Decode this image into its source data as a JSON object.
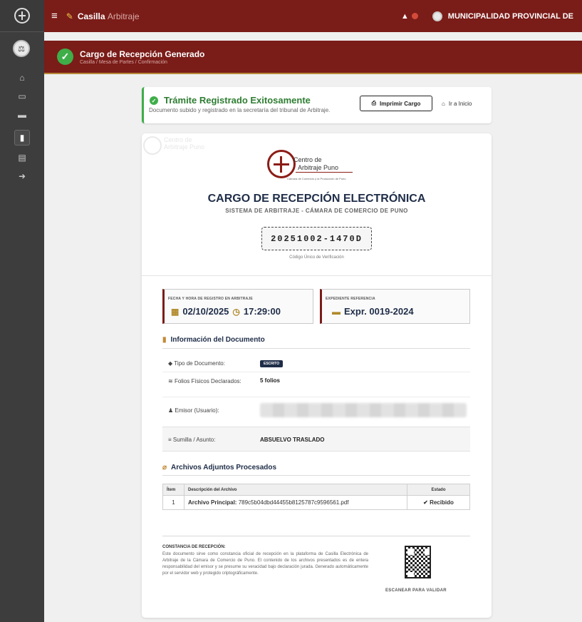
{
  "topbar": {
    "title_bold": "Casilla",
    "title_rest": "Arbitraje",
    "organization": "MUNICIPALIDAD PROVINCIAL DE"
  },
  "banner": {
    "title": "Cargo de Recepción Generado",
    "breadcrumb": "Casilla / Mesa de Partes / Confirmación"
  },
  "success": {
    "title": "Trámite Registrado Exitosamente",
    "description": "Documento subido y registrado en la secretaría del tribunal de Arbitraje.",
    "print_label": "Imprimir Cargo",
    "home_label": "Ir a Inicio"
  },
  "document": {
    "watermark_line1": "Centro de",
    "watermark_line2": "Arbitraje Puno",
    "logo_line1": "Centro de",
    "logo_line2": "Arbitraje Puno",
    "logo_tagline": "Cámara de Comercio y la Producción de Puno",
    "title": "CARGO DE RECEPCIÓN ELECTRÓNICA",
    "subtitle": "SISTEMA DE ARBITRAJE - CÁMARA DE COMERCIO DE PUNO",
    "code": "20251002-1470D",
    "code_label": "Código Único de Verificación",
    "registro_label": "FECHA Y HORA DE REGISTRO EN ARBITRAJE",
    "registro_date": "02/10/2025",
    "registro_time": "17:29:00",
    "expediente_label": "EXPEDIENTE REFERENCIA",
    "expediente_value": "Expr. 0019-2024",
    "info_title": "Información del Documento",
    "tipo_label": "Tipo de Documento:",
    "tipo_value": "ESCRITO",
    "folios_label": "Folios Físicos Declarados:",
    "folios_value": "5 folios",
    "emisor_label": "Emisor (Usuario):",
    "sumilla_label": "Sumilla / Asunto:",
    "sumilla_value": "ABSUELVO TRASLADO",
    "files_title": "Archivos Adjuntos Procesados",
    "files_headers": [
      "Ítem",
      "Descripción del Archivo",
      "Estado"
    ],
    "files_rows": [
      {
        "item": "1",
        "prefix": "Archivo Principal:",
        "name": "789c5b04dbd44455b8125787c9596561.pdf",
        "status": "Recibido"
      }
    ],
    "constancia_title": "CONSTANCIA DE RECEPCIÓN:",
    "constancia_text": "Este documento sirve como constancia oficial de recepción en la plataforma de Casilla Electrónica de Arbitraje de la Cámara de Comercio de Puno. El contenido de los archivos presentados es de entera responsabilidad del emisor y se presume su veracidad bajo declaración jurada. Generado automáticamente por el servidor web y protegido criptográficamente.",
    "qr_label": "ESCANEAR PARA VALIDAR"
  },
  "colors": {
    "brand": "#7a1c18",
    "success": "#3fae49",
    "navy": "#1f2d48",
    "gold": "#b0892a"
  }
}
